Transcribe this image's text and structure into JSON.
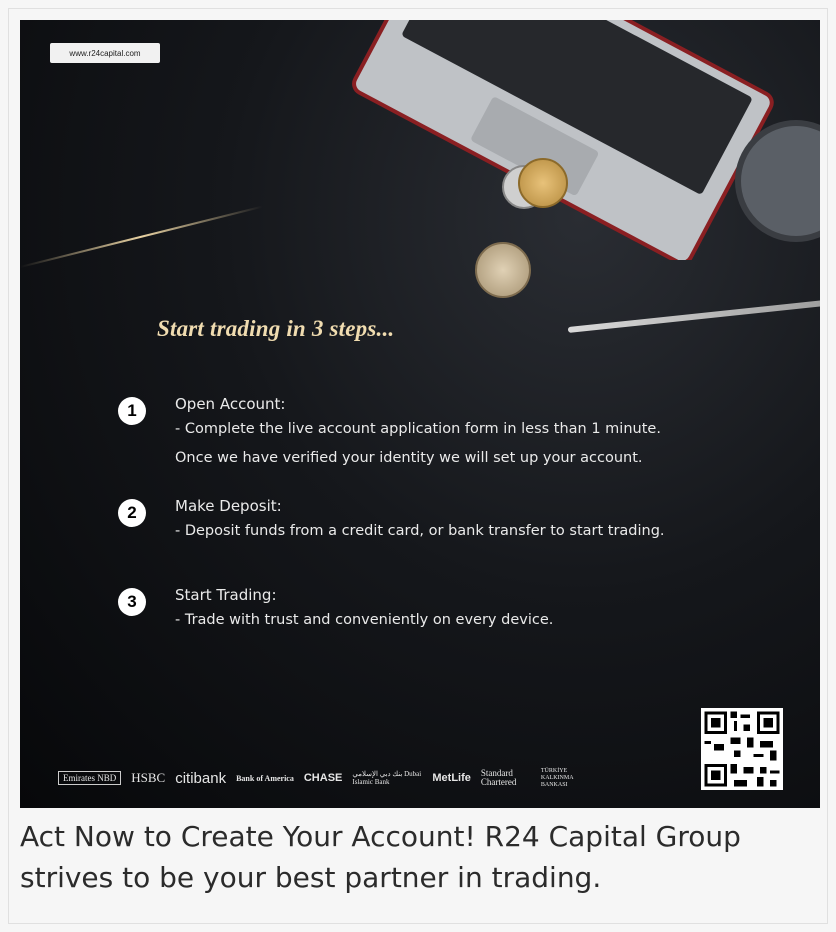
{
  "banner": {
    "url": "www.r24capital.com",
    "headline": "Start trading in 3 steps...",
    "steps": [
      {
        "number": "1",
        "title": "Open Account:",
        "line1": " - Complete the live account application form in less than 1 minute.",
        "line2": "Once we have verified your identity we will set up your account."
      },
      {
        "number": "2",
        "title": "Make Deposit:",
        "line1": " - Deposit funds from a credit card, or bank transfer to start trading."
      },
      {
        "number": "3",
        "title": "Start Trading:",
        "line1": " - Trade with trust and conveniently on every device."
      }
    ],
    "partner_logos": [
      "Emirates NBD",
      "HSBC",
      "citibank",
      "Bank of America",
      "CHASE",
      "بنك دبي الإسلامي Dubai Islamic Bank",
      "MetLife",
      "Standard Chartered",
      "TÜRKİYE KALKINMA BANKASI"
    ]
  },
  "caption": "Act Now to Create Your Account! R24 Capital Group strives to be your best partner in trading.",
  "colors": {
    "headline": "#f0dcb0",
    "banner_bg": "#0b0c0f",
    "caption_text": "#2b2b2b"
  }
}
